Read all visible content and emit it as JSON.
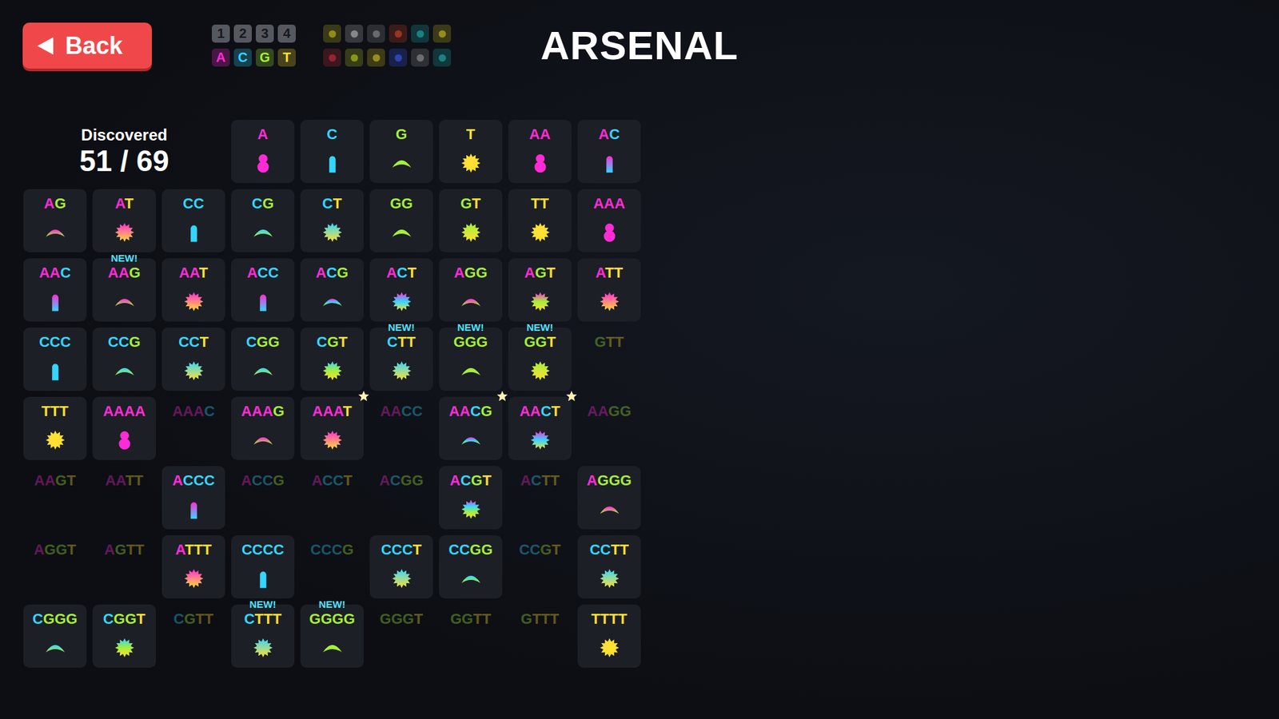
{
  "back_button": {
    "label": "Back"
  },
  "legend": {
    "numbers": [
      "1",
      "2",
      "3",
      "4"
    ],
    "letters": [
      {
        "letter": "A",
        "color": "#ff2bd6"
      },
      {
        "letter": "C",
        "color": "#33d6ff"
      },
      {
        "letter": "G",
        "color": "#a6ee3a"
      },
      {
        "letter": "T",
        "color": "#ffe033"
      }
    ]
  },
  "modifiers": [
    {
      "color": "#d8d020"
    },
    {
      "color": "#c8c8c8"
    },
    {
      "color": "#9a9a9a"
    },
    {
      "color": "#e04a2a"
    },
    {
      "color": "#20c0c0"
    },
    {
      "color": "#e0d020"
    },
    {
      "color": "#e03040"
    },
    {
      "color": "#c8e020"
    },
    {
      "color": "#e8d020"
    },
    {
      "color": "#4060ff"
    },
    {
      "color": "#a0a0a0"
    },
    {
      "color": "#20c0c0"
    }
  ],
  "title": "ARSENAL",
  "discovered": {
    "label": "Discovered",
    "count": "51 / 69"
  },
  "new_badge": "NEW!",
  "items": [
    {
      "label": "A",
      "discovered": true,
      "new": false,
      "starred": false
    },
    {
      "label": "C",
      "discovered": true,
      "new": false,
      "starred": false
    },
    {
      "label": "G",
      "discovered": true,
      "new": false,
      "starred": false
    },
    {
      "label": "T",
      "discovered": true,
      "new": false,
      "starred": false
    },
    {
      "label": "AA",
      "discovered": true,
      "new": false,
      "starred": false
    },
    {
      "label": "AC",
      "discovered": true,
      "new": false,
      "starred": false
    },
    {
      "label": "AG",
      "discovered": true,
      "new": false,
      "starred": false
    },
    {
      "label": "AT",
      "discovered": true,
      "new": false,
      "starred": false
    },
    {
      "label": "CC",
      "discovered": true,
      "new": false,
      "starred": false
    },
    {
      "label": "CG",
      "discovered": true,
      "new": false,
      "starred": false
    },
    {
      "label": "CT",
      "discovered": true,
      "new": false,
      "starred": false
    },
    {
      "label": "GG",
      "discovered": true,
      "new": false,
      "starred": false
    },
    {
      "label": "GT",
      "discovered": true,
      "new": false,
      "starred": false
    },
    {
      "label": "TT",
      "discovered": true,
      "new": false,
      "starred": false
    },
    {
      "label": "AAA",
      "discovered": true,
      "new": false,
      "starred": false
    },
    {
      "label": "AAC",
      "discovered": true,
      "new": false,
      "starred": false
    },
    {
      "label": "AAG",
      "discovered": true,
      "new": true,
      "starred": false
    },
    {
      "label": "AAT",
      "discovered": true,
      "new": false,
      "starred": false
    },
    {
      "label": "ACC",
      "discovered": true,
      "new": false,
      "starred": false
    },
    {
      "label": "ACG",
      "discovered": true,
      "new": false,
      "starred": false
    },
    {
      "label": "ACT",
      "discovered": true,
      "new": false,
      "starred": false
    },
    {
      "label": "AGG",
      "discovered": true,
      "new": false,
      "starred": false
    },
    {
      "label": "AGT",
      "discovered": true,
      "new": false,
      "starred": false
    },
    {
      "label": "ATT",
      "discovered": true,
      "new": false,
      "starred": false
    },
    {
      "label": "CCC",
      "discovered": true,
      "new": false,
      "starred": false
    },
    {
      "label": "CCG",
      "discovered": true,
      "new": false,
      "starred": false
    },
    {
      "label": "CCT",
      "discovered": true,
      "new": false,
      "starred": false
    },
    {
      "label": "CGG",
      "discovered": true,
      "new": false,
      "starred": false
    },
    {
      "label": "CGT",
      "discovered": true,
      "new": false,
      "starred": false
    },
    {
      "label": "CTT",
      "discovered": true,
      "new": true,
      "starred": false
    },
    {
      "label": "GGG",
      "discovered": true,
      "new": true,
      "starred": false
    },
    {
      "label": "GGT",
      "discovered": true,
      "new": true,
      "starred": false
    },
    {
      "label": "GTT",
      "discovered": false,
      "new": false,
      "starred": false
    },
    {
      "label": "TTT",
      "discovered": true,
      "new": false,
      "starred": false
    },
    {
      "label": "AAAA",
      "discovered": true,
      "new": false,
      "starred": false
    },
    {
      "label": "AAAC",
      "discovered": false,
      "new": false,
      "starred": false
    },
    {
      "label": "AAAG",
      "discovered": true,
      "new": false,
      "starred": false
    },
    {
      "label": "AAAT",
      "discovered": true,
      "new": false,
      "starred": true
    },
    {
      "label": "AACC",
      "discovered": false,
      "new": false,
      "starred": false
    },
    {
      "label": "AACG",
      "discovered": true,
      "new": false,
      "starred": true
    },
    {
      "label": "AACT",
      "discovered": true,
      "new": false,
      "starred": true
    },
    {
      "label": "AAGG",
      "discovered": false,
      "new": false,
      "starred": false
    },
    {
      "label": "AAGT",
      "discovered": false,
      "new": false,
      "starred": false
    },
    {
      "label": "AATT",
      "discovered": false,
      "new": false,
      "starred": false
    },
    {
      "label": "ACCC",
      "discovered": true,
      "new": false,
      "starred": false
    },
    {
      "label": "ACCG",
      "discovered": false,
      "new": false,
      "starred": false
    },
    {
      "label": "ACCT",
      "discovered": false,
      "new": false,
      "starred": false
    },
    {
      "label": "ACGG",
      "discovered": false,
      "new": false,
      "starred": false
    },
    {
      "label": "ACGT",
      "discovered": true,
      "new": false,
      "starred": false
    },
    {
      "label": "ACTT",
      "discovered": false,
      "new": false,
      "starred": false
    },
    {
      "label": "AGGG",
      "discovered": true,
      "new": false,
      "starred": false
    },
    {
      "label": "AGGT",
      "discovered": false,
      "new": false,
      "starred": false
    },
    {
      "label": "AGTT",
      "discovered": false,
      "new": false,
      "starred": false
    },
    {
      "label": "ATTT",
      "discovered": true,
      "new": false,
      "starred": false
    },
    {
      "label": "CCCC",
      "discovered": true,
      "new": false,
      "starred": false
    },
    {
      "label": "CCCG",
      "discovered": false,
      "new": false,
      "starred": false
    },
    {
      "label": "CCCT",
      "discovered": true,
      "new": false,
      "starred": false
    },
    {
      "label": "CCGG",
      "discovered": true,
      "new": false,
      "starred": false
    },
    {
      "label": "CCGT",
      "discovered": false,
      "new": false,
      "starred": false
    },
    {
      "label": "CCTT",
      "discovered": true,
      "new": false,
      "starred": false
    },
    {
      "label": "CGGG",
      "discovered": true,
      "new": false,
      "starred": false
    },
    {
      "label": "CGGT",
      "discovered": true,
      "new": false,
      "starred": false
    },
    {
      "label": "CGTT",
      "discovered": false,
      "new": false,
      "starred": false
    },
    {
      "label": "CTTT",
      "discovered": true,
      "new": true,
      "starred": false
    },
    {
      "label": "GGGG",
      "discovered": true,
      "new": true,
      "starred": false
    },
    {
      "label": "GGGT",
      "discovered": false,
      "new": false,
      "starred": false
    },
    {
      "label": "GGTT",
      "discovered": false,
      "new": false,
      "starred": false
    },
    {
      "label": "GTTT",
      "discovered": false,
      "new": false,
      "starred": false
    },
    {
      "label": "TTTT",
      "discovered": true,
      "new": false,
      "starred": false
    }
  ]
}
